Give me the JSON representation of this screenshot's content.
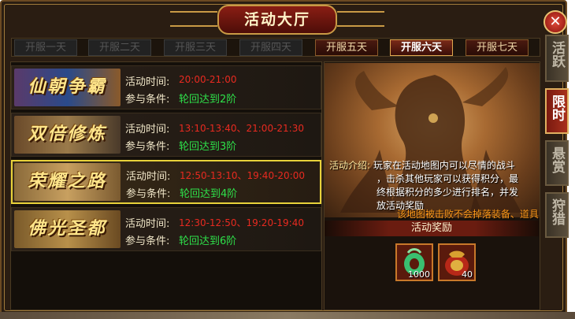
{
  "window": {
    "title": "活动大厅",
    "close_label": "✕"
  },
  "tabs": [
    {
      "label": "开服一天",
      "state": "disabled"
    },
    {
      "label": "开服二天",
      "state": "disabled"
    },
    {
      "label": "开服三天",
      "state": "disabled"
    },
    {
      "label": "开服四天",
      "state": "disabled"
    },
    {
      "label": "开服五天",
      "state": "enabled"
    },
    {
      "label": "开服六天",
      "state": "active"
    },
    {
      "label": "开服七天",
      "state": "enabled"
    }
  ],
  "activity_labels": {
    "time": "活动时间:",
    "condition": "参与条件:"
  },
  "activities": [
    {
      "banner": "仙朝争霸",
      "time": "20:00-21:00",
      "condition": "轮回达到2阶"
    },
    {
      "banner": "双倍修炼",
      "time": "13:10-13:40、21:00-21:30",
      "condition": "轮回达到3阶"
    },
    {
      "banner": "荣耀之路",
      "time": "12:50-13:10、19:40-20:00",
      "condition": "轮回达到4阶",
      "selected": true
    },
    {
      "banner": "佛光圣都",
      "time": "12:30-12:50、19:20-19:40",
      "condition": "轮回达到6阶"
    }
  ],
  "detail": {
    "desc_label": "活动介绍:",
    "desc_lines": [
      "玩家在活动地图内可以尽情的战斗",
      "，击杀其他玩家可以获得积分，最",
      "终根据积分的多少进行排名，并发",
      "放活动奖励"
    ],
    "warning": "该地图被击败不会掉落装备、道具",
    "reward_title": "活动奖励",
    "rewards": [
      {
        "icon": "jade-pendant-icon",
        "count": "1000"
      },
      {
        "icon": "gift-bag-icon",
        "count": "40"
      }
    ]
  },
  "side_tabs": [
    {
      "label": "活跃",
      "active": false
    },
    {
      "label": "限时",
      "active": true
    },
    {
      "label": "悬赏",
      "active": false
    },
    {
      "label": "狩猎",
      "active": false
    }
  ],
  "colors": {
    "time": "#e82a20",
    "condition": "#2ee04a",
    "selected_border": "#e8d23a",
    "warning": "#ff9a1a"
  }
}
